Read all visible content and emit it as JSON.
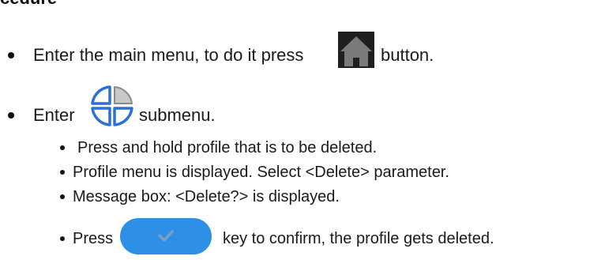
{
  "heading_fragment": "cedure",
  "steps": [
    {
      "text_before": "Enter the main menu, to do it press",
      "icon": "home-icon",
      "text_after": "button."
    },
    {
      "text_before": "Enter",
      "icon": "profile-quadrant-icon",
      "text_after": "submenu."
    }
  ],
  "substeps": [
    {
      "text": "Press and hold profile that is to be deleted."
    },
    {
      "text": "Profile menu is displayed. Select <Delete> parameter."
    },
    {
      "text": "Message box: <Delete?> is displayed."
    },
    {
      "text_before": "Press",
      "icon": "confirm-checkmark-icon",
      "text_after": "key to confirm, the profile gets deleted."
    }
  ],
  "colors": {
    "home_icon_bg": "#1f1f1f",
    "home_icon_house": "#7a7a7a",
    "quadrant_blue": "#2f6fd8",
    "quadrant_gray": "#c8c8c8",
    "confirm_button": "#2e8fe6",
    "checkmark": "#7d9fbf"
  }
}
